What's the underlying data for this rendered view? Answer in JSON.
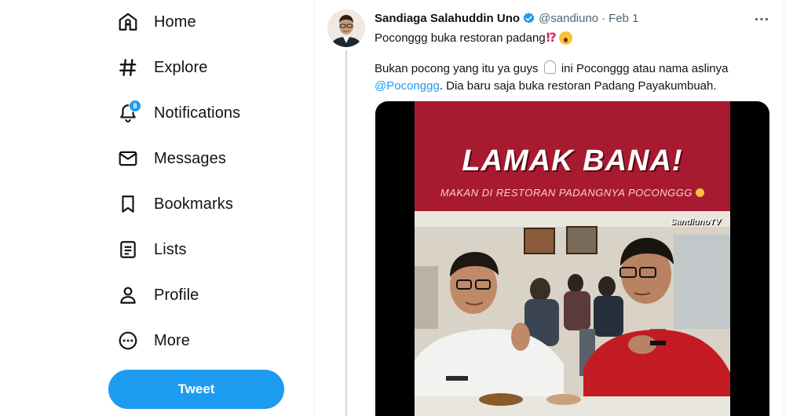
{
  "sidebar": {
    "items": [
      {
        "label": "Home",
        "icon": "home-icon"
      },
      {
        "label": "Explore",
        "icon": "hashtag-icon"
      },
      {
        "label": "Notifications",
        "icon": "bell-icon",
        "badge": "8"
      },
      {
        "label": "Messages",
        "icon": "envelope-icon"
      },
      {
        "label": "Bookmarks",
        "icon": "bookmark-icon"
      },
      {
        "label": "Lists",
        "icon": "list-icon"
      },
      {
        "label": "Profile",
        "icon": "person-icon"
      },
      {
        "label": "More",
        "icon": "more-circle-icon"
      }
    ],
    "tweet_button": "Tweet"
  },
  "tweet": {
    "author": "Sandiaga Salahuddin Uno",
    "handle": "@sandiuno",
    "separator": "·",
    "date": "Feb 1",
    "line1_text": "Poconggg buka restoran padang",
    "line1_emoji": "⁉",
    "body_part1": "Bukan pocong yang itu ya guys",
    "body_part2": "ini Poconggg atau nama aslinya",
    "mention": "@Poconggg",
    "body_part3": ". Dia baru saja buka restoran Padang Payakumbuah.",
    "media": {
      "headline": "LAMAK BANA!",
      "subline": "MAKAN DI RESTORAN PADANGNYA POCONGGG",
      "watermark": "SandiunoTV"
    }
  },
  "colors": {
    "accent": "#1d9bf0",
    "video_red": "#a81a30"
  }
}
